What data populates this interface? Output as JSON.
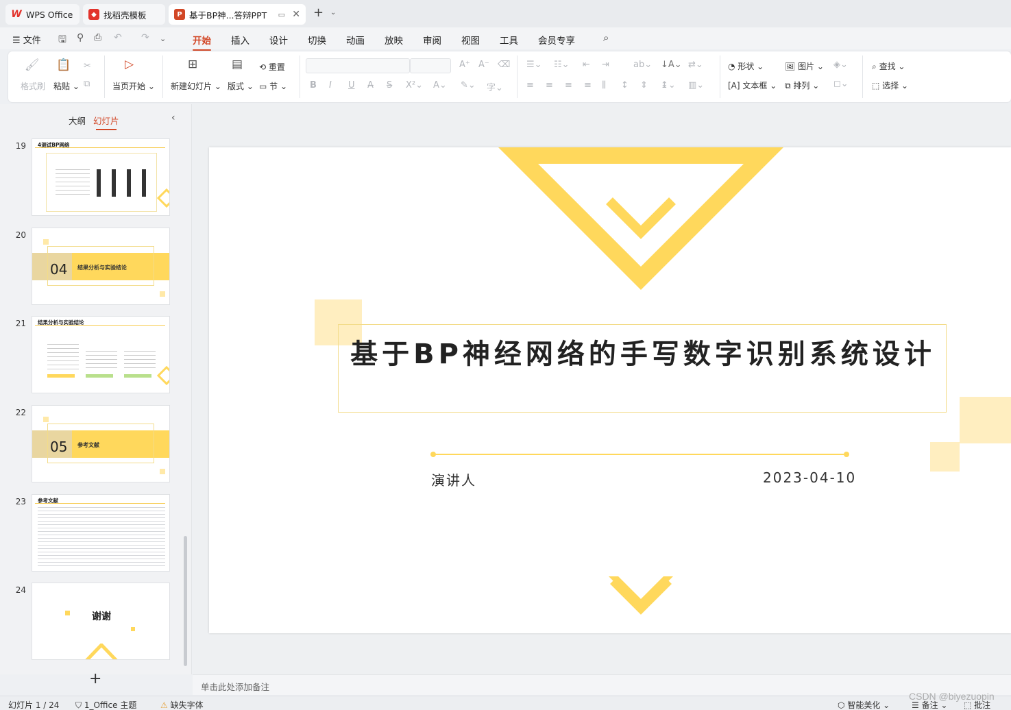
{
  "tabs": [
    {
      "label": "WPS Office",
      "icon": "wps-logo-icon"
    },
    {
      "label": "找稻壳模板",
      "icon": "docer-logo-icon"
    },
    {
      "label": "基于BP神...答辩PPT",
      "icon": "ppt-file-icon"
    }
  ],
  "menu": {
    "file": "文件",
    "items": [
      "开始",
      "插入",
      "设计",
      "切换",
      "动画",
      "放映",
      "审阅",
      "视图",
      "工具",
      "会员专享"
    ],
    "active": "开始"
  },
  "ribbon": {
    "format_painter": "格式刷",
    "paste": "粘贴",
    "play_from_current": "当页开始",
    "new_slide": "新建幻灯片",
    "layout": "版式",
    "reset": "重置",
    "section": "节",
    "shape": "形状",
    "picture": "图片",
    "textbox": "文本框",
    "arrange": "排列",
    "find": "查找",
    "select": "选择"
  },
  "panel": {
    "outline_tab": "大纲",
    "slides_tab": "幻灯片",
    "slides": [
      {
        "num": "19",
        "title": "4测试BP网络"
      },
      {
        "num": "20",
        "section_num": "04",
        "title": "结果分析与实验结论"
      },
      {
        "num": "21",
        "title": "结果分析与实验结论"
      },
      {
        "num": "22",
        "section_num": "05",
        "title": "参考文献"
      },
      {
        "num": "23",
        "title": "参考文献"
      },
      {
        "num": "24",
        "title": "谢谢"
      }
    ]
  },
  "slide": {
    "title": "基于BP神经网络的手写数字识别系统设计",
    "presenter_label": "演讲人",
    "date": "2023-04-10",
    "accent_color": "#FFD85C",
    "light_color": "#FFEEC0"
  },
  "notes_placeholder": "单击此处添加备注",
  "status": {
    "slide_counter": "幻灯片 1 / 24",
    "theme": "1_Office 主题",
    "missing_font": "缺失字体",
    "smart_beautify": "智能美化",
    "notes": "备注",
    "comments": "批注"
  },
  "watermark": "CSDN @biyezuopin"
}
